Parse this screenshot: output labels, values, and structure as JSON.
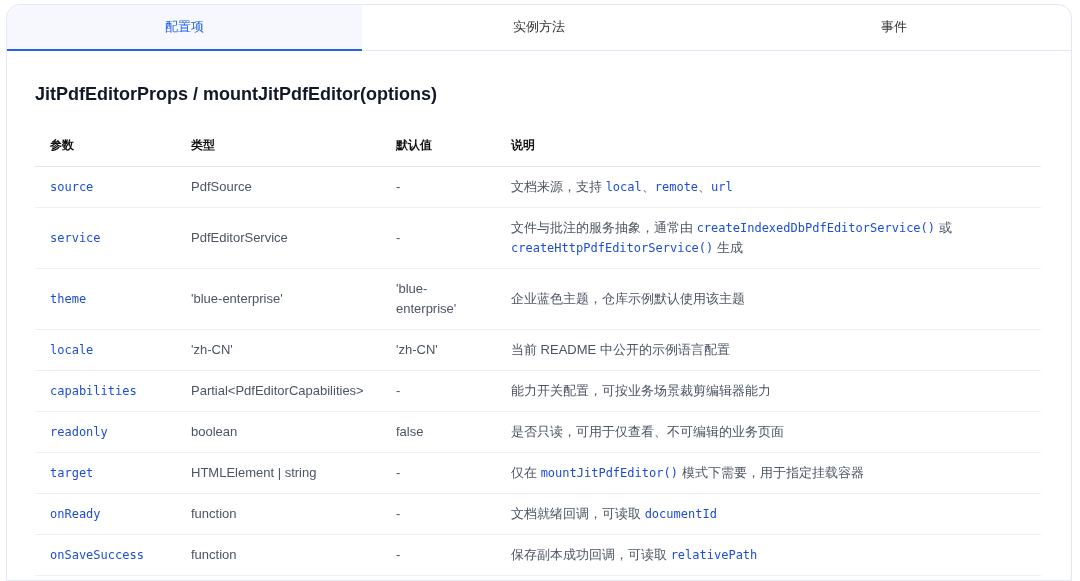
{
  "tabs": [
    {
      "label": "配置项",
      "selected": true
    },
    {
      "label": "实例方法",
      "selected": false
    },
    {
      "label": "事件",
      "selected": false
    }
  ],
  "section_title": "JitPdfEditorProps / mountJitPdfEditor(options)",
  "table": {
    "columns": [
      "参数",
      "类型",
      "默认值",
      "说明"
    ],
    "rows": [
      {
        "param": "source",
        "type": "PdfSource",
        "default": "-",
        "description": [
          {
            "kind": "text",
            "text": "文档来源，支持 "
          },
          {
            "kind": "code",
            "text": "local"
          },
          {
            "kind": "text",
            "text": "、"
          },
          {
            "kind": "code",
            "text": "remote"
          },
          {
            "kind": "text",
            "text": "、"
          },
          {
            "kind": "code",
            "text": "url"
          }
        ]
      },
      {
        "param": "service",
        "type": "PdfEditorService",
        "default": "-",
        "description": [
          {
            "kind": "text",
            "text": "文件与批注的服务抽象，通常由 "
          },
          {
            "kind": "code",
            "text": "createIndexedDbPdfEditorService()"
          },
          {
            "kind": "text",
            "text": " 或 "
          },
          {
            "kind": "code",
            "text": "createHttpPdfEditorService()"
          },
          {
            "kind": "text",
            "text": " 生成"
          }
        ]
      },
      {
        "param": "theme",
        "type": "'blue-enterprise'",
        "default": "'blue-enterprise'",
        "description": [
          {
            "kind": "text",
            "text": "企业蓝色主题，仓库示例默认使用该主题"
          }
        ]
      },
      {
        "param": "locale",
        "type": "'zh-CN'",
        "default": "'zh-CN'",
        "description": [
          {
            "kind": "text",
            "text": "当前 README 中公开的示例语言配置"
          }
        ]
      },
      {
        "param": "capabilities",
        "type": "Partial<PdfEditorCapabilities>",
        "default": "-",
        "description": [
          {
            "kind": "text",
            "text": "能力开关配置，可按业务场景裁剪编辑器能力"
          }
        ]
      },
      {
        "param": "readonly",
        "type": "boolean",
        "default": "false",
        "description": [
          {
            "kind": "text",
            "text": "是否只读，可用于仅查看、不可编辑的业务页面"
          }
        ]
      },
      {
        "param": "target",
        "type": "HTMLElement | string",
        "default": "-",
        "description": [
          {
            "kind": "text",
            "text": "仅在 "
          },
          {
            "kind": "code",
            "text": "mountJitPdfEditor()"
          },
          {
            "kind": "text",
            "text": " 模式下需要，用于指定挂载容器"
          }
        ]
      },
      {
        "param": "onReady",
        "type": "function",
        "default": "-",
        "description": [
          {
            "kind": "text",
            "text": "文档就绪回调，可读取 "
          },
          {
            "kind": "code",
            "text": "documentId"
          }
        ]
      },
      {
        "param": "onSaveSuccess",
        "type": "function",
        "default": "-",
        "description": [
          {
            "kind": "text",
            "text": "保存副本成功回调，可读取 "
          },
          {
            "kind": "code",
            "text": "relativePath"
          }
        ]
      }
    ]
  }
}
